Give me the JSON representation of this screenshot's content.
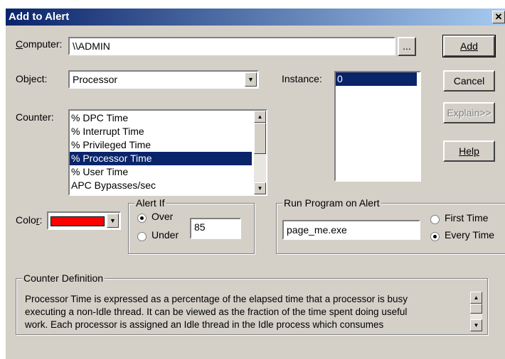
{
  "window": {
    "title": "Add to Alert",
    "close_glyph": "✕"
  },
  "computer": {
    "label": "Computer:",
    "value": "\\\\ADMIN",
    "browse_label": "..."
  },
  "object": {
    "label": "Object:",
    "value": "Processor"
  },
  "instance": {
    "label": "Instance:",
    "items": [
      "0"
    ]
  },
  "counter": {
    "label": "Counter:",
    "items": [
      "% DPC Time",
      "% Interrupt Time",
      "% Privileged Time",
      "% Processor Time",
      "% User Time",
      "APC Bypasses/sec"
    ],
    "selected": "% Processor Time"
  },
  "buttons": {
    "add": "Add",
    "cancel": "Cancel",
    "explain": "Explain>>",
    "help": "Help"
  },
  "color": {
    "label": "Color:",
    "value": "#ff0000"
  },
  "alert_if": {
    "title": "Alert If",
    "over": "Over",
    "under": "Under",
    "selected": "Over",
    "value": "85"
  },
  "run_program": {
    "title": "Run Program on Alert",
    "value": "page_me.exe",
    "first_time": "First Time",
    "every_time": "Every Time",
    "selected": "Every Time"
  },
  "definition": {
    "title": "Counter Definition",
    "lines": [
      "Processor Time is expressed as a percentage of the elapsed time that a processor is busy",
      "executing a non-Idle thread.  It can be viewed as the fraction of the time spent doing useful",
      "work.  Each processor is assigned an Idle thread in the Idle process which consumes"
    ]
  }
}
